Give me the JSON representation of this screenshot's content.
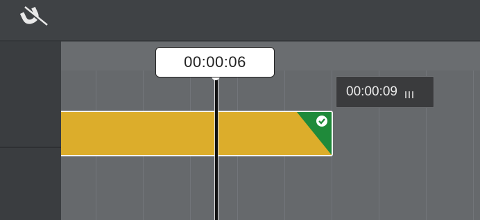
{
  "toolbar": {
    "snap_icon": "magnet-snap-off-icon"
  },
  "playhead": {
    "timecode": "00:00:06"
  },
  "clip": {
    "status_icon": "check-circle-icon",
    "accent_color": "#dcad2b",
    "corner_color": "#1f8a3a"
  },
  "duration_tooltip": {
    "timecode": "00:00:09",
    "grip_icon": "drag-grip-icon"
  },
  "colors": {
    "toolbar_bg": "#3f4245",
    "timeline_bg": "#66696c",
    "track_header_bg": "#3a3d40"
  }
}
